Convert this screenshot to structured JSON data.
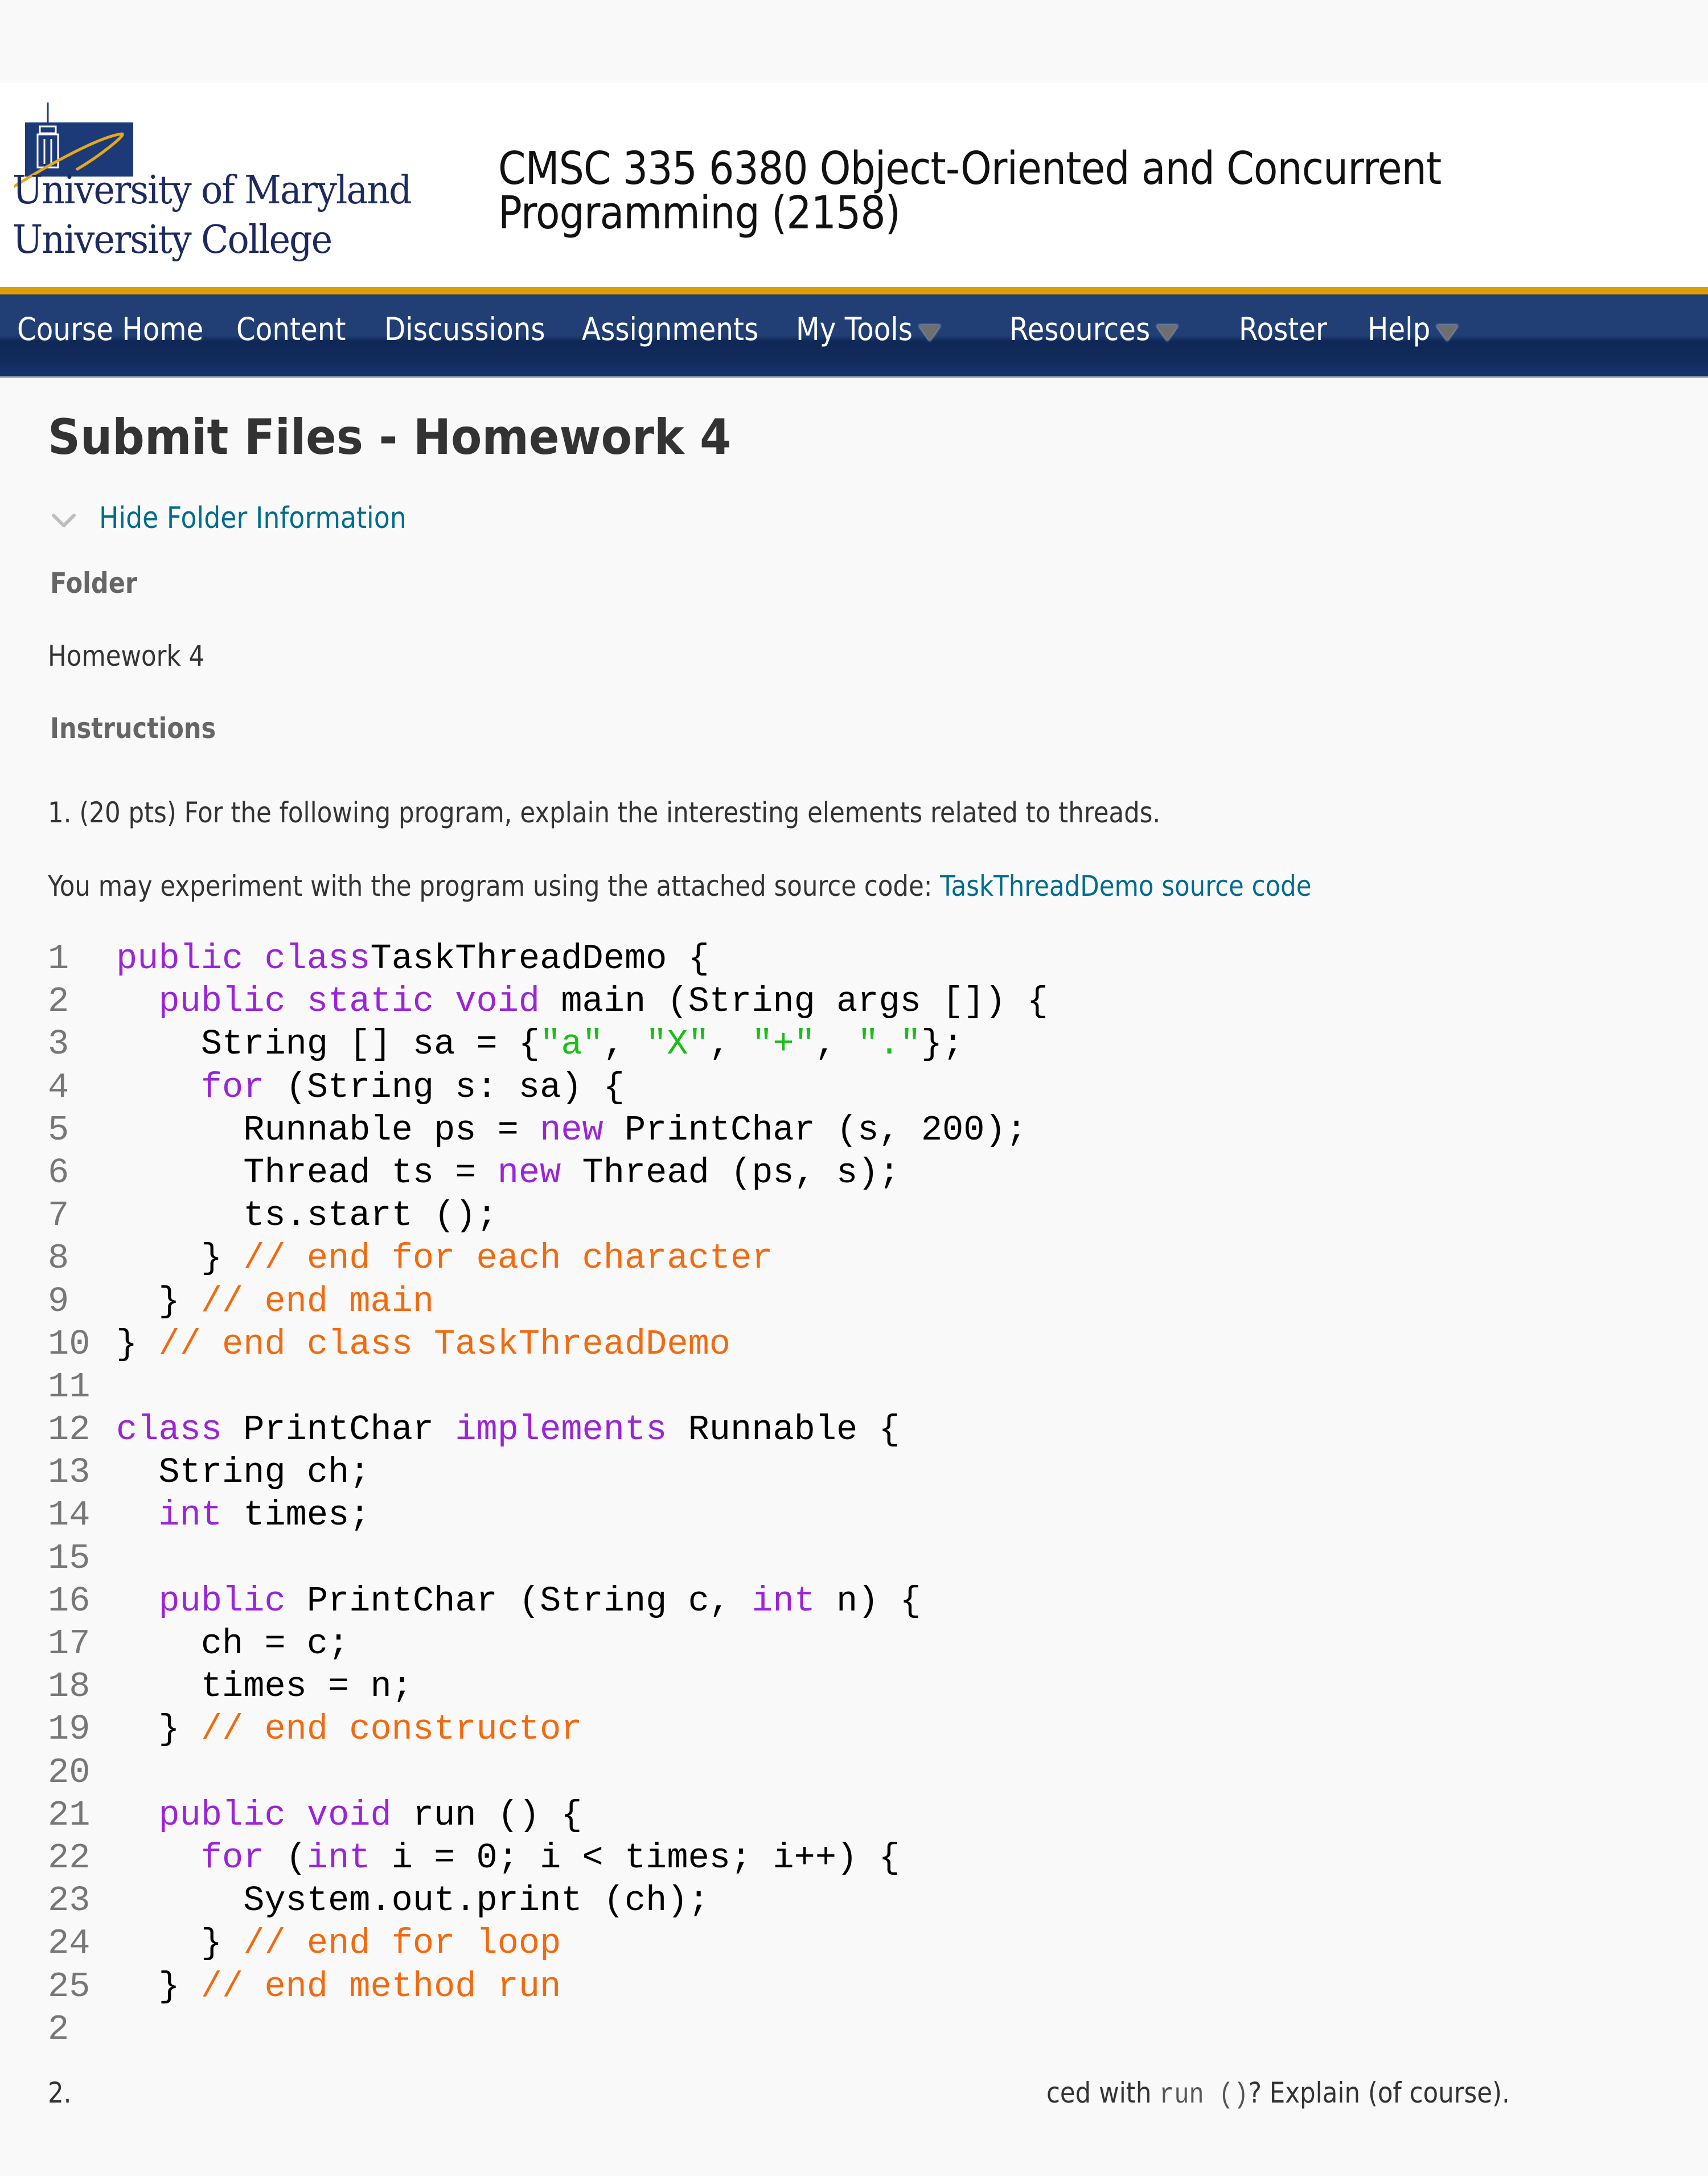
{
  "header": {
    "logo": {
      "line1": "University of Maryland",
      "line2": "University College"
    },
    "course_title_line1": "CMSC 335 6380 Object-Oriented and Concurrent",
    "course_title_line2": "Programming (2158)"
  },
  "nav": {
    "items": [
      {
        "label": "Course Home",
        "dropdown": false
      },
      {
        "label": "Content",
        "dropdown": false
      },
      {
        "label": "Discussions",
        "dropdown": false
      },
      {
        "label": "Assignments",
        "dropdown": false
      },
      {
        "label": "My Tools",
        "dropdown": true
      },
      {
        "label": "Resources",
        "dropdown": true
      },
      {
        "label": "Roster",
        "dropdown": false
      },
      {
        "label": "Help",
        "dropdown": true
      }
    ]
  },
  "page": {
    "title": "Submit Files - Homework 4",
    "toggle_folder_label": "Hide Folder Information",
    "folder_heading": "Folder",
    "folder_value": "Homework 4",
    "instructions_heading": "Instructions",
    "question1": "1. (20 pts) For the following program, explain the interesting elements related to threads.",
    "experiment_text": "You may experiment with the program using the attached source code: ",
    "source_link": "TaskThreadDemo source code",
    "question2_number": "2.",
    "question2_prefix": "ced with ",
    "question2_code": "run ()",
    "question2_suffix": "? Explain (of course)."
  },
  "code": {
    "lines": [
      {
        "n": "1",
        "tokens": [
          [
            "kw",
            "public class"
          ],
          [
            "",
            "TaskThreadDemo {"
          ]
        ]
      },
      {
        "n": "2",
        "tokens": [
          [
            "",
            "  "
          ],
          [
            "kw",
            "public static void"
          ],
          [
            "",
            " main (String args []) {"
          ]
        ]
      },
      {
        "n": "3",
        "tokens": [
          [
            "",
            "    String [] sa = {"
          ],
          [
            "str",
            "\"a\""
          ],
          [
            "",
            ", "
          ],
          [
            "str",
            "\"X\""
          ],
          [
            "",
            ", "
          ],
          [
            "str",
            "\"+\""
          ],
          [
            "",
            ", "
          ],
          [
            "str",
            "\".\""
          ],
          [
            "",
            "};"
          ]
        ]
      },
      {
        "n": "4",
        "tokens": [
          [
            "",
            "    "
          ],
          [
            "kw",
            "for"
          ],
          [
            "",
            " (String s: sa) {"
          ]
        ]
      },
      {
        "n": "5",
        "tokens": [
          [
            "",
            "      Runnable ps = "
          ],
          [
            "kw",
            "new"
          ],
          [
            "",
            " PrintChar (s, 200);"
          ]
        ]
      },
      {
        "n": "6",
        "tokens": [
          [
            "",
            "      Thread ts = "
          ],
          [
            "kw",
            "new"
          ],
          [
            "",
            " Thread (ps, s);"
          ]
        ]
      },
      {
        "n": "7",
        "tokens": [
          [
            "",
            "      ts.start ();"
          ]
        ]
      },
      {
        "n": "8",
        "tokens": [
          [
            "",
            "    } "
          ],
          [
            "cm",
            "// end for each character"
          ]
        ]
      },
      {
        "n": "9",
        "tokens": [
          [
            "",
            "  } "
          ],
          [
            "cm",
            "// end main"
          ]
        ]
      },
      {
        "n": "10",
        "tokens": [
          [
            "",
            "} "
          ],
          [
            "cm",
            "// end class TaskThreadDemo"
          ]
        ]
      },
      {
        "n": "11",
        "tokens": []
      },
      {
        "n": "12",
        "tokens": [
          [
            "kw",
            "class"
          ],
          [
            "",
            " PrintChar "
          ],
          [
            "kw",
            "implements"
          ],
          [
            "",
            " Runnable {"
          ]
        ]
      },
      {
        "n": "13",
        "tokens": [
          [
            "",
            "  String ch;"
          ]
        ]
      },
      {
        "n": "14",
        "tokens": [
          [
            "",
            "  "
          ],
          [
            "kw",
            "int"
          ],
          [
            "",
            " times;"
          ]
        ]
      },
      {
        "n": "15",
        "tokens": []
      },
      {
        "n": "16",
        "tokens": [
          [
            "",
            "  "
          ],
          [
            "kw",
            "public"
          ],
          [
            "",
            " PrintChar (String c, "
          ],
          [
            "kw",
            "int"
          ],
          [
            "",
            " n) {"
          ]
        ]
      },
      {
        "n": "17",
        "tokens": [
          [
            "",
            "    ch = c;"
          ]
        ]
      },
      {
        "n": "18",
        "tokens": [
          [
            "",
            "    times = n;"
          ]
        ]
      },
      {
        "n": "19",
        "tokens": [
          [
            "",
            "  } "
          ],
          [
            "cm",
            "// end constructor"
          ]
        ]
      },
      {
        "n": "20",
        "tokens": []
      },
      {
        "n": "21",
        "tokens": [
          [
            "",
            "  "
          ],
          [
            "kw",
            "public void"
          ],
          [
            "",
            " run () {"
          ]
        ]
      },
      {
        "n": "22",
        "tokens": [
          [
            "",
            "    "
          ],
          [
            "kw",
            "for"
          ],
          [
            "",
            " ("
          ],
          [
            "kw",
            "int"
          ],
          [
            "",
            " i = 0; i < times; i++) {"
          ]
        ]
      },
      {
        "n": "23",
        "tokens": [
          [
            "",
            "      System.out.print (ch);"
          ]
        ]
      },
      {
        "n": "24",
        "tokens": [
          [
            "",
            "    } "
          ],
          [
            "cm",
            "// end for loop"
          ]
        ]
      },
      {
        "n": "25",
        "tokens": [
          [
            "",
            "  } "
          ],
          [
            "cm",
            "// end method run"
          ]
        ]
      },
      {
        "n": "2",
        "tokens": []
      }
    ]
  },
  "colors": {
    "brand_navy": "#213f74",
    "brand_gold": "#dc9e00",
    "link": "#006c8b",
    "keyword": "#9a24d8",
    "string": "#1bbd1b",
    "comment": "#f26a0f"
  }
}
